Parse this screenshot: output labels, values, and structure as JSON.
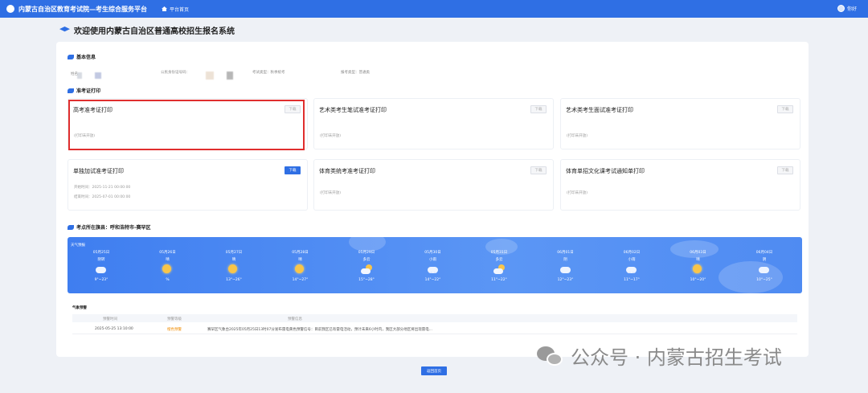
{
  "header": {
    "system_title": "内蒙古自治区教育考试院—考生综合服务平台",
    "home_label": "平台首页",
    "user_name": "你好"
  },
  "page": {
    "title": "欢迎使用内蒙古自治区普通高校招生报名系统"
  },
  "basic_info": {
    "section_title": "基本信息",
    "name_label": "姓名",
    "id_label": "公民身份证号码：",
    "exam_type_label": "考试类型：秋季统考",
    "category_label": "报考类型：普通类"
  },
  "admission": {
    "section_title": "准考证打印",
    "cards": [
      {
        "title": "高考准考证打印",
        "button": "下载",
        "active": false,
        "notes": [
          "(打印未开放)"
        ]
      },
      {
        "title": "艺术类考生笔试准考证打印",
        "button": "下载",
        "active": false,
        "notes": [
          "(打印未开放)"
        ]
      },
      {
        "title": "艺术类考生面试准考证打印",
        "button": "下载",
        "active": false,
        "notes": [
          "(打印未开放)"
        ]
      },
      {
        "title": "单独加试准考证打印",
        "button": "下载",
        "active": true,
        "notes": [
          "开始时间：2025-11-21 00:00:00",
          "结束时间：2025-07-01 00:00:00"
        ]
      },
      {
        "title": "体育类统考准考证打印",
        "button": "下载",
        "active": false,
        "notes": [
          "(打印未开放)"
        ]
      },
      {
        "title": "体育单招文化课考试通知单打印",
        "button": "下载",
        "active": false,
        "notes": [
          "(打印未开放)"
        ]
      }
    ]
  },
  "location": {
    "section_title": "考点所在旗县：呼和浩特市-赛罕区"
  },
  "weather": {
    "header": "天气预报",
    "days": [
      {
        "date": "05月25日",
        "condition": "阴转",
        "icon": "cloudy-icon",
        "temp": "9°~23°"
      },
      {
        "date": "05月26日",
        "condition": "晴",
        "icon": "sun-icon",
        "temp": "%"
      },
      {
        "date": "05月27日",
        "condition": "晴",
        "icon": "sun-icon",
        "temp": "13°~26°"
      },
      {
        "date": "05月28日",
        "condition": "晴",
        "icon": "sun-icon",
        "temp": "14°~27°"
      },
      {
        "date": "05月29日",
        "condition": "多云",
        "icon": "partly-cloudy-icon",
        "temp": "15°~28°"
      },
      {
        "date": "05月30日",
        "condition": "小雨",
        "icon": "rain-icon",
        "temp": "14°~22°"
      },
      {
        "date": "05月31日",
        "condition": "多云",
        "icon": "partly-cloudy-icon",
        "temp": "11°~22°"
      },
      {
        "date": "06月01日",
        "condition": "阴",
        "icon": "cloudy-icon",
        "temp": "12°~23°"
      },
      {
        "date": "06月02日",
        "condition": "小雨",
        "icon": "rain-icon",
        "temp": "11°~17°"
      },
      {
        "date": "06月03日",
        "condition": "晴",
        "icon": "sun-icon",
        "temp": "10°~20°"
      },
      {
        "date": "06月04日",
        "condition": "阴",
        "icon": "cloudy-icon",
        "temp": "10°~25°"
      }
    ]
  },
  "alerts": {
    "title": "气象预警",
    "headers": [
      "预警时间",
      "预警等级",
      "预警信息"
    ],
    "rows": [
      {
        "time": "2025-05-25 13:10:00",
        "level": "橙色预警",
        "info": "赛罕区气象台2025年05月25日13时07分发布雷电黄色预警信号：目前我区已有雷电活动，预计未来6小时内，我区大部分地区将出现雷电..."
      }
    ]
  },
  "footer": {
    "back_button": "返回首页"
  },
  "watermark": {
    "text": "公众号 · 内蒙古招生考试"
  },
  "colors": {
    "primary": "#2f6fe4",
    "highlight_border": "#e02e2e",
    "warning": "#f08c00"
  }
}
